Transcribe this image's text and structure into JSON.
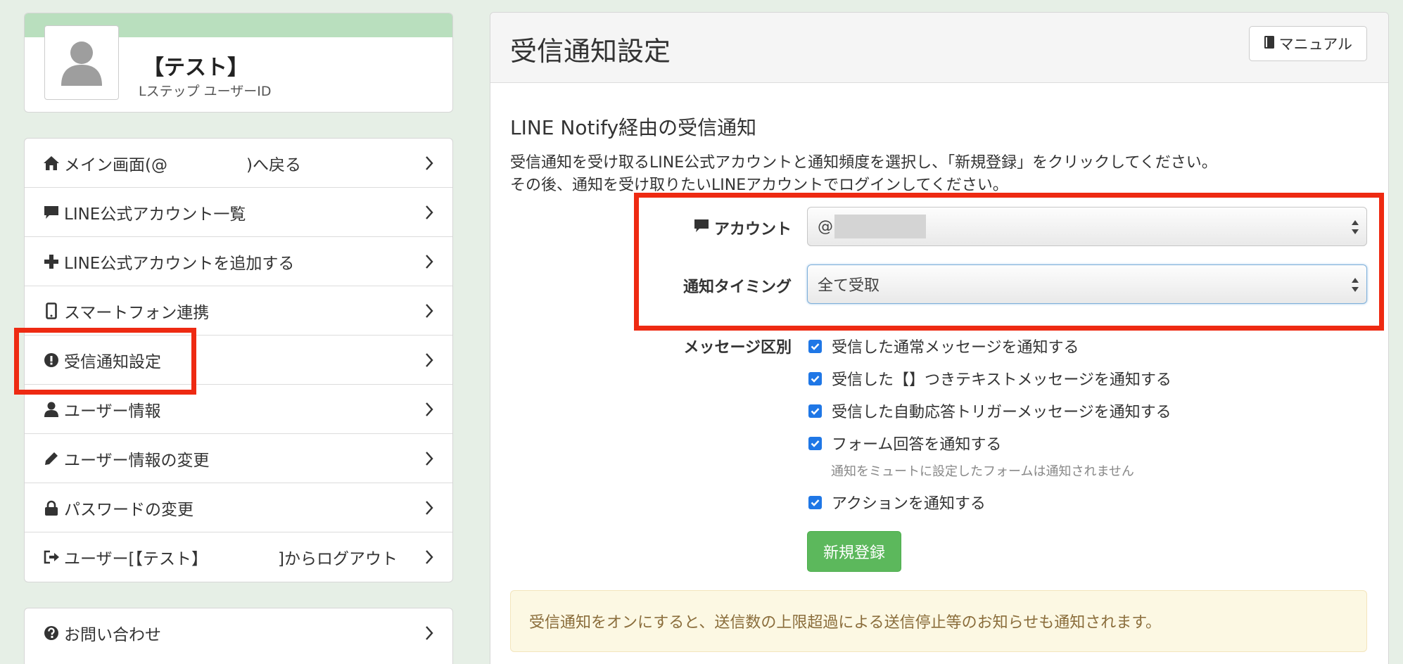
{
  "profile": {
    "name": "【テスト】",
    "sub": "Lステップ ユーザーID"
  },
  "menu": {
    "items": [
      {
        "icon": "home-icon",
        "label_a": "メイン画面(@",
        "label_b": ")へ戻る"
      },
      {
        "icon": "comment-icon",
        "label": "LINE公式アカウント一覧"
      },
      {
        "icon": "plus-icon",
        "label": "LINE公式アカウントを追加する"
      },
      {
        "icon": "mobile-icon",
        "label": "スマートフォン連携"
      },
      {
        "icon": "alert-circle-icon",
        "label": "受信通知設定"
      },
      {
        "icon": "user-icon",
        "label": "ユーザー情報"
      },
      {
        "icon": "pencil-icon",
        "label": "ユーザー情報の変更"
      },
      {
        "icon": "lock-icon",
        "label": "パスワードの変更"
      },
      {
        "icon": "logout-icon",
        "label_a": "ユーザー[【テスト】",
        "label_b": "]からログアウト"
      }
    ],
    "secondary": [
      {
        "icon": "question-circle-icon",
        "label": "お問い合わせ"
      }
    ]
  },
  "main": {
    "title": "受信通知設定",
    "manual_button": "マニュアル",
    "section_title": "LINE Notify経由の受信通知",
    "description_line1": "受信通知を受け取るLINE公式アカウントと通知頻度を選択し、「新規登録」をクリックしてください。",
    "description_line2": "その後、通知を受け取りたいLINEアカウントでログインしてください。",
    "form": {
      "account_label": "アカウント",
      "account_value": "@",
      "timing_label": "通知タイミング",
      "timing_value": "全て受取",
      "message_label": "メッセージ区別",
      "checkboxes": [
        {
          "label": "受信した通常メッセージを通知する",
          "checked": true
        },
        {
          "label": "受信した【】つきテキストメッセージを通知する",
          "checked": true
        },
        {
          "label": "受信した自動応答トリガーメッセージを通知する",
          "checked": true
        },
        {
          "label": "フォーム回答を通知する",
          "checked": true
        },
        {
          "label": "アクションを通知する",
          "checked": true
        }
      ],
      "form_hint": "通知をミュートに設定したフォームは通知されません",
      "submit_button": "新規登録"
    },
    "notice": "受信通知をオンにすると、送信数の上限超過による送信停止等のお知らせも通知されます。"
  },
  "colors": {
    "highlight": "#ee2a12",
    "accent_green": "#5cb85c",
    "checkbox_blue": "#1f77e6",
    "profile_band": "#b9dfbe"
  }
}
